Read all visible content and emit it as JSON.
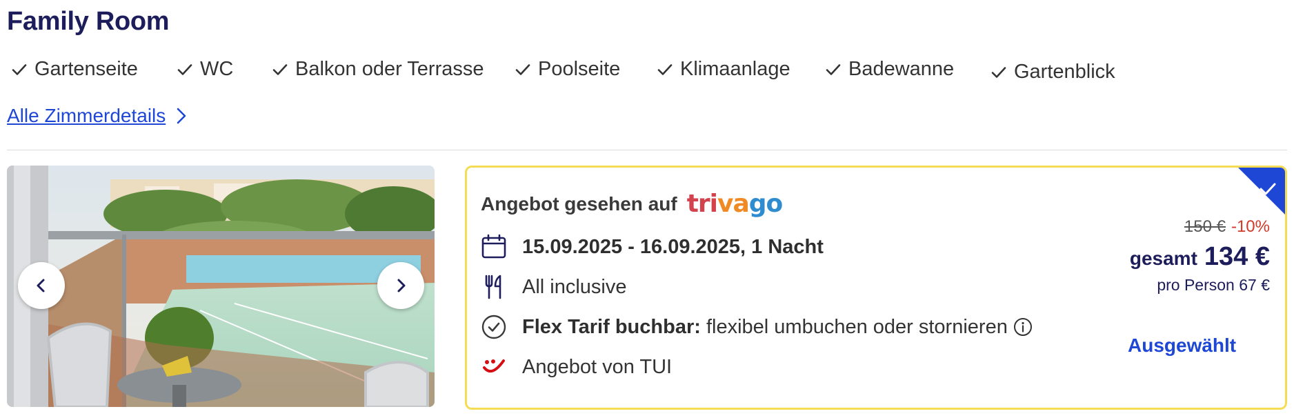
{
  "room": {
    "title": "Family Room"
  },
  "features": [
    {
      "label": "Gartenseite"
    },
    {
      "label": "WC"
    },
    {
      "label": "Balkon oder Terrasse"
    },
    {
      "label": "Poolseite"
    },
    {
      "label": "Klimaanlage"
    },
    {
      "label": "Badewanne"
    },
    {
      "label": "Gartenblick"
    }
  ],
  "details_link": {
    "label": "Alle Zimmerdetails",
    "icon": "chevron-right-icon"
  },
  "gallery": {
    "prev_icon": "chevron-left-icon",
    "next_icon": "chevron-right-icon"
  },
  "offer": {
    "seen_label": "Angebot gesehen auf",
    "provider_logo": {
      "part1": "tri",
      "part2": "va",
      "part3": "go"
    },
    "dates": "15.09.2025 - 16.09.2025, 1 Nacht",
    "board": "All inclusive",
    "flex_bold": "Flex Tarif buchbar:",
    "flex_text": "flexibel umbuchen oder stornieren",
    "operator": "Angebot von TUI",
    "old_price": "150 €",
    "discount": "-10%",
    "total_label": "gesamt",
    "total_price": "134 €",
    "per_person": "pro Person 67 €",
    "selected_label": "Ausgewählt",
    "selected": true
  },
  "colors": {
    "title": "#1d1d5c",
    "link": "#1e47d6",
    "card_border": "#f4dd55",
    "discount": "#d13a2a",
    "selected_badge": "#1e47d6",
    "tui_red": "#d40e14"
  }
}
